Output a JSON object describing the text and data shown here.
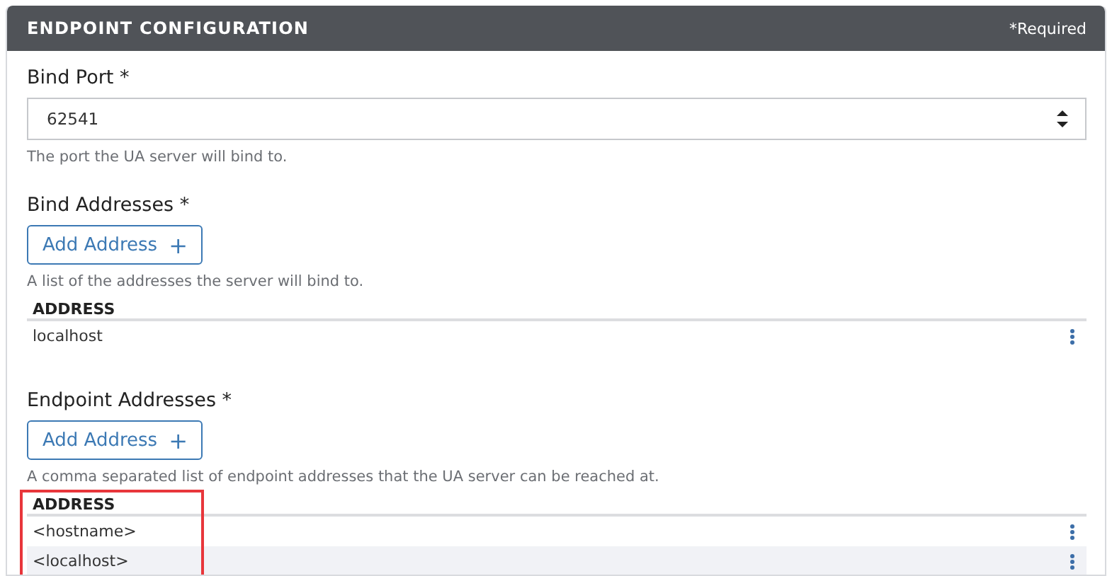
{
  "panel": {
    "title": "ENDPOINT CONFIGURATION",
    "required_note": "*Required"
  },
  "bind_port": {
    "label": "Bind Port *",
    "value": "62541",
    "help": "The port the UA server will bind to."
  },
  "bind_addresses": {
    "label": "Bind Addresses *",
    "button": "Add Address",
    "button_icon": "+",
    "help": "A list of the addresses the server will bind to.",
    "column": "ADDRESS",
    "rows": [
      "localhost"
    ]
  },
  "endpoint_addresses": {
    "label": "Endpoint Addresses *",
    "button": "Add Address",
    "button_icon": "+",
    "help": "A comma separated list of endpoint addresses that the UA server can be reached at.",
    "column": "ADDRESS",
    "rows": [
      "<hostname>",
      "<localhost>"
    ],
    "highlighted": true
  }
}
